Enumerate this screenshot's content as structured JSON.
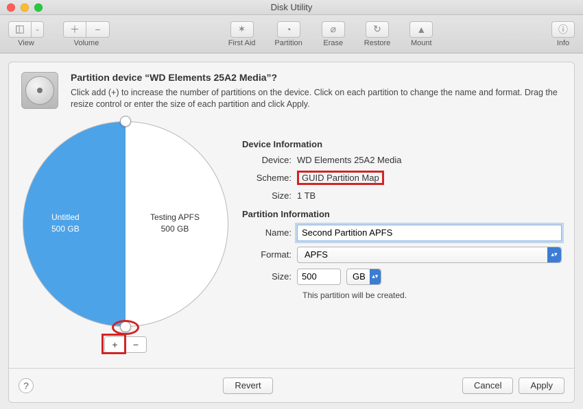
{
  "window": {
    "title": "Disk Utility"
  },
  "toolbar": {
    "view": "View",
    "volume": "Volume",
    "first_aid": "First Aid",
    "partition": "Partition",
    "erase": "Erase",
    "restore": "Restore",
    "mount": "Mount",
    "info": "Info"
  },
  "header": {
    "title": "Partition device “WD Elements 25A2 Media”?",
    "desc": "Click add (+) to increase the number of partitions on the device. Click on each partition to change the name and format. Drag the resize control or enter the size of each partition and click Apply."
  },
  "pie": {
    "left_name": "Untitled",
    "left_size": "500 GB",
    "right_name": "Testing APFS",
    "right_size": "500 GB",
    "plus": "+",
    "minus": "−"
  },
  "device_info": {
    "heading": "Device Information",
    "device_label": "Device:",
    "device_value": "WD Elements 25A2 Media",
    "scheme_label": "Scheme:",
    "scheme_value": "GUID Partition Map",
    "size_label": "Size:",
    "size_value": "1 TB"
  },
  "partition_info": {
    "heading": "Partition Information",
    "name_label": "Name:",
    "name_value": "Second Partition APFS",
    "format_label": "Format:",
    "format_value": "APFS",
    "size_label": "Size:",
    "size_value": "500",
    "size_unit": "GB",
    "note": "This partition will be created."
  },
  "buttons": {
    "revert": "Revert",
    "cancel": "Cancel",
    "apply": "Apply",
    "help": "?"
  },
  "chart_data": {
    "type": "pie",
    "title": "Partition layout",
    "categories": [
      "Untitled",
      "Testing APFS"
    ],
    "values": [
      500,
      500
    ],
    "unit": "GB",
    "total": 1000
  }
}
